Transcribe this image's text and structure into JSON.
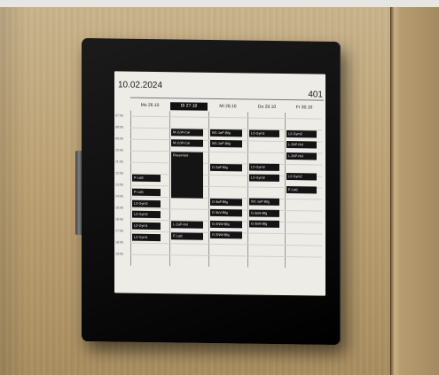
{
  "display": {
    "date": "10.02.2024",
    "room": "401",
    "days": [
      "Mo 26.10",
      "Di 27.10",
      "Mi 28.10",
      "Do 29.10",
      "Fr 30.10"
    ],
    "times": [
      "07:00",
      "08:00",
      "09:00",
      "10:00",
      "11:00",
      "12:00",
      "13:00",
      "14:00",
      "15:00",
      "16:00",
      "17:00",
      "18:00",
      "19:00"
    ],
    "events": {
      "mo": [
        "F-Lat1",
        "F-Lat1",
        "L2-Gym2",
        "L2-Gym2",
        "L2-Gym1",
        "L2-Gym1"
      ],
      "di": [
        "M-1LW-Car",
        "M-1LW-Car",
        "Reserviert",
        "L-2aP-Hsl",
        "F-Lat1"
      ],
      "mi": [
        "W1-1eP-Bfg",
        "W1-1eP-Bfg",
        "G-2aF-Bfg",
        "G-3eF-Bfg",
        "G-3eV-Bfg",
        "G-2NW-Bfg",
        "G-2NW-Bfg"
      ],
      "do": [
        "L2-Gym1",
        "L2-Gym3",
        "L2-Gym3",
        "W1-1eP-Bfg",
        "G-3eN-Bfg",
        "G-3eN-Bfg"
      ],
      "fr": [
        "L2-Gym3",
        "L-2bP-Hsl",
        "L-2bP-Hsl",
        "L2-Gym2",
        "F-Lat1"
      ]
    }
  }
}
